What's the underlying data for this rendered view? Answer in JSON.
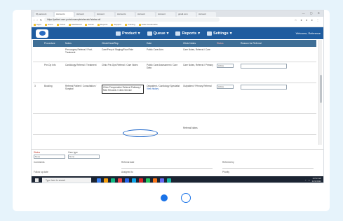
{
  "browser": {
    "tabs": [
      "My account",
      "Accounts",
      "Account",
      "Account",
      "Accounts",
      "Account",
      "Account",
      "gmail.com",
      "Account"
    ],
    "window_controls": "— ▢ ✕",
    "address": "https://patient.care-portal.example/referrals?status=all",
    "bookmarks": [
      "Apps",
      "Home",
      "Portal",
      "Dashboard",
      "Admin",
      "Reports",
      "Support",
      "Training",
      "Other bookmarks"
    ]
  },
  "app": {
    "nav": [
      "Product",
      "Queue",
      "Reports",
      "Settings"
    ],
    "user": "Welcome, Reference"
  },
  "table": {
    "headers": [
      "",
      "Procedure",
      "Notes",
      "Clinic/Care/Rep",
      "Date",
      "Clinic Notes",
      "Status",
      "Reason for Referral"
    ],
    "rows": [
      {
        "num": "",
        "procedure": "",
        "notes": "Pre-surgery Referral / Post-Treatment",
        "detail": "Care/Prep of Staging/Flow Rate",
        "date": "Public Care Adm.",
        "clinic": "Care Notes, Referral / Care",
        "status": "",
        "reason": ""
      },
      {
        "num": "",
        "procedure": "Pre-Op Info",
        "notes": "Cardiology Referral / Treatment",
        "detail": "Clinic Pre-Ops Referral / Care Notes",
        "date": "Public Care Assessment / Care Data",
        "clinic": "Care Notes, Referral / Primary",
        "status": "Active",
        "reason": ""
      },
      {
        "num": "3",
        "procedure": "Booking",
        "notes": "Referral Patient / Consultation / Surgical",
        "detail": "Clinic Preoperative Referral Pathway / Med Records / Clinic Service",
        "date": "Outpatient / Cardiology Specialist",
        "clinic": "Outpatient / Primary Referral",
        "status": "Active",
        "reason": ""
      }
    ],
    "link_text": "View history",
    "row4_note": "Referral Notes"
  },
  "form": {
    "l1": "Status",
    "l2": "Care type",
    "sel1": "None",
    "sel2": "None",
    "l3": "Comments",
    "l4": "Referral date",
    "l5": "Referred by",
    "l6": "Follow up date",
    "l7": "Assigned to",
    "l8": "Priority"
  },
  "taskbar": {
    "search": "Type here to search",
    "time": "10:52 AM",
    "date": "1/21/2022"
  },
  "colors": {
    "app_header": "#1f5c9f",
    "table_header": "#3f6f96",
    "accent": "#1a73e8"
  }
}
